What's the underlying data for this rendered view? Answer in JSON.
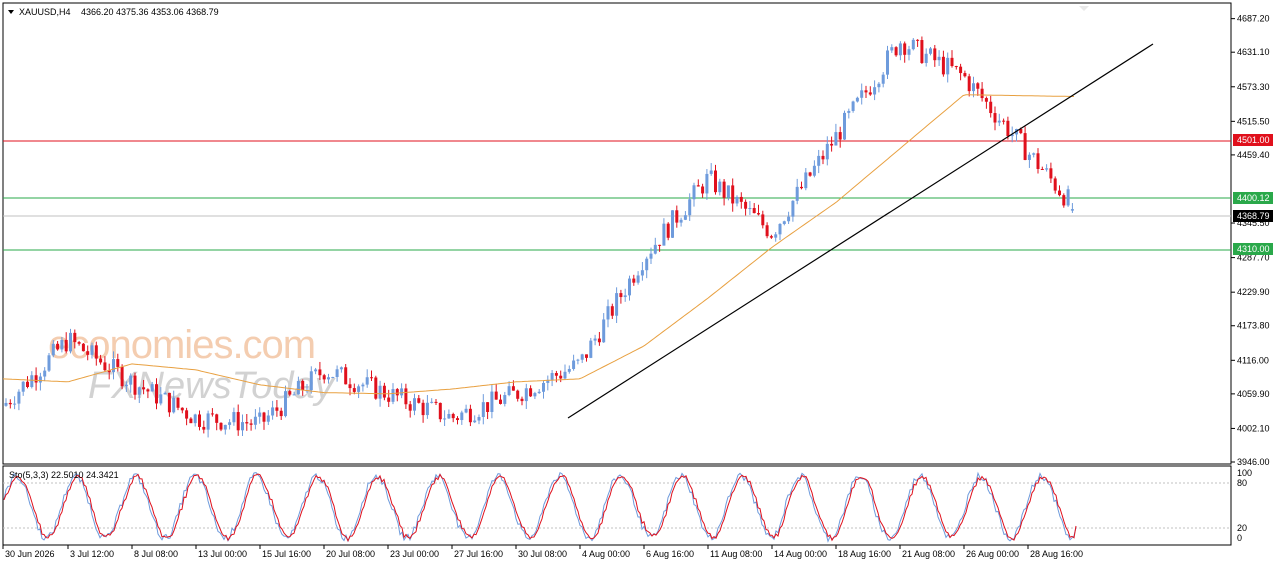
{
  "header": {
    "symbol": "XAUUSD,H4",
    "ohlc": "4366.20 4375.36 4353.06 4368.79"
  },
  "watermark": {
    "brand": "economies.com",
    "brand2": "FXNewsToday"
  },
  "levels": {
    "resistance": {
      "value": 4501.0,
      "label": "4501.00",
      "color": "#e0101c"
    },
    "upper_support": {
      "value": 4400.12,
      "label": "4400.12",
      "color": "#2aa84a"
    },
    "current": {
      "value": 4368.79,
      "label": "4368.79",
      "color": "#000000"
    },
    "lower_support": {
      "value": 4310.0,
      "label": "4310.00",
      "color": "#2aa84a"
    }
  },
  "price_axis": {
    "ticks": [
      "4687.20",
      "4631.10",
      "4573.30",
      "4515.50",
      "4459.40",
      "4345.50",
      "4287.70",
      "4229.90",
      "4173.80",
      "4116.00",
      "4059.90",
      "4002.10",
      "3946.00"
    ]
  },
  "stoch_axis": {
    "ticks": [
      "100",
      "80",
      "20",
      "0"
    ]
  },
  "time_axis": {
    "labels": [
      "30 Jun 2026",
      "3 Jul 12:00",
      "8 Jul 08:00",
      "13 Jul 00:00",
      "15 Jul 16:00",
      "20 Jul 08:00",
      "23 Jul 00:00",
      "27 Jul 16:00",
      "30 Jul 08:00",
      "4 Aug 00:00",
      "6 Aug 16:00",
      "11 Aug 08:00",
      "14 Aug 00:00",
      "18 Aug 16:00",
      "21 Aug 08:00",
      "26 Aug 00:00",
      "28 Aug 16:00"
    ]
  },
  "stoch_label": "Sto(5,3,3) 22.5010 24.3421",
  "colors": {
    "bull": "#6e9bdc",
    "bear": "#e0101c",
    "ma": "#e8a040",
    "trendline": "#000000",
    "stoch_main": "#6e9bdc",
    "stoch_signal": "#e0101c"
  },
  "chart_data": [
    {
      "type": "candlestick",
      "title": "XAUUSD,H4",
      "timeframe": "H4",
      "ylim": [
        3946.0,
        4710.0
      ],
      "last_candle": {
        "open": 4366.2,
        "high": 4375.36,
        "low": 4353.06,
        "close": 4368.79
      },
      "close_path": {
        "x": [
          "30 Jun 2026",
          "3 Jul 12:00",
          "8 Jul 08:00",
          "13 Jul 00:00",
          "15 Jul 16:00",
          "20 Jul 08:00",
          "23 Jul 00:00",
          "27 Jul 16:00",
          "30 Jul 08:00",
          "4 Aug 00:00",
          "6 Aug 16:00",
          "11 Aug 08:00",
          "14 Aug 00:00",
          "18 Aug 16:00",
          "21 Aug 08:00",
          "26 Aug 00:00",
          "28 Aug 16:00"
        ],
        "y": [
          4040,
          4150,
          4080,
          4020,
          4010,
          4100,
          4060,
          4020,
          4060,
          4110,
          4290,
          4420,
          4330,
          4490,
          4650,
          4590,
          4368.79
        ]
      },
      "moving_average": {
        "x": [
          "30 Jun 2026",
          "3 Jul 12:00",
          "8 Jul 08:00",
          "13 Jul 00:00",
          "15 Jul 16:00",
          "20 Jul 08:00",
          "23 Jul 00:00",
          "27 Jul 16:00",
          "30 Jul 08:00",
          "4 Aug 00:00",
          "6 Aug 16:00",
          "11 Aug 08:00",
          "14 Aug 00:00",
          "18 Aug 16:00",
          "21 Aug 08:00",
          "26 Aug 00:00",
          "28 Aug 16:00"
        ],
        "y": [
          4085,
          4080,
          4110,
          4100,
          4075,
          4062,
          4060,
          4068,
          4080,
          4085,
          4140,
          4220,
          4305,
          4380,
          4470,
          4560,
          4557
        ]
      },
      "trendline": {
        "from": {
          "x": "30 Jul 08:00",
          "y": 4020
        },
        "to": {
          "x": "28 Aug 16:00",
          "y": 4665
        }
      },
      "horizontal_levels": [
        4501.0,
        4400.12,
        4368.79,
        4310.0
      ]
    },
    {
      "type": "line",
      "title": "Sto(5,3,3) 22.5010 24.3421",
      "ylim": [
        0,
        100
      ],
      "levels": [
        80,
        20
      ],
      "last_values": {
        "main": 22.501,
        "signal": 24.3421
      }
    }
  ]
}
